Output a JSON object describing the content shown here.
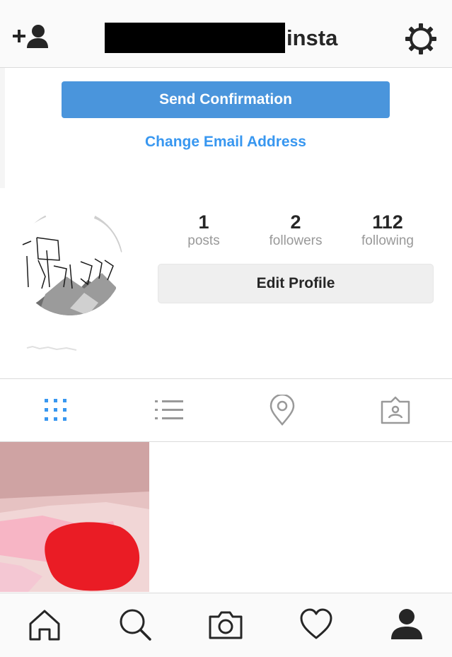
{
  "header": {
    "title_suffix": "insta",
    "add_user_icon": "add-user-icon",
    "settings_icon": "gear-icon"
  },
  "confirmation": {
    "send_label": "Send Confirmation",
    "change_email_label": "Change Email Address"
  },
  "profile": {
    "stats": [
      {
        "value": "1",
        "label": "posts"
      },
      {
        "value": "2",
        "label": "followers"
      },
      {
        "value": "112",
        "label": "following"
      }
    ],
    "edit_label": "Edit Profile"
  },
  "tabs": [
    {
      "icon": "grid-icon",
      "active": true
    },
    {
      "icon": "list-icon",
      "active": false
    },
    {
      "icon": "location-pin-icon",
      "active": false
    },
    {
      "icon": "tagged-photo-icon",
      "active": false
    }
  ],
  "bottom_nav": [
    {
      "icon": "home-icon"
    },
    {
      "icon": "search-icon"
    },
    {
      "icon": "camera-icon"
    },
    {
      "icon": "heart-icon"
    },
    {
      "icon": "profile-icon"
    }
  ],
  "colors": {
    "accent": "#3897f0",
    "button_blue": "#4a95dc",
    "text": "#262626",
    "muted": "#999999"
  }
}
